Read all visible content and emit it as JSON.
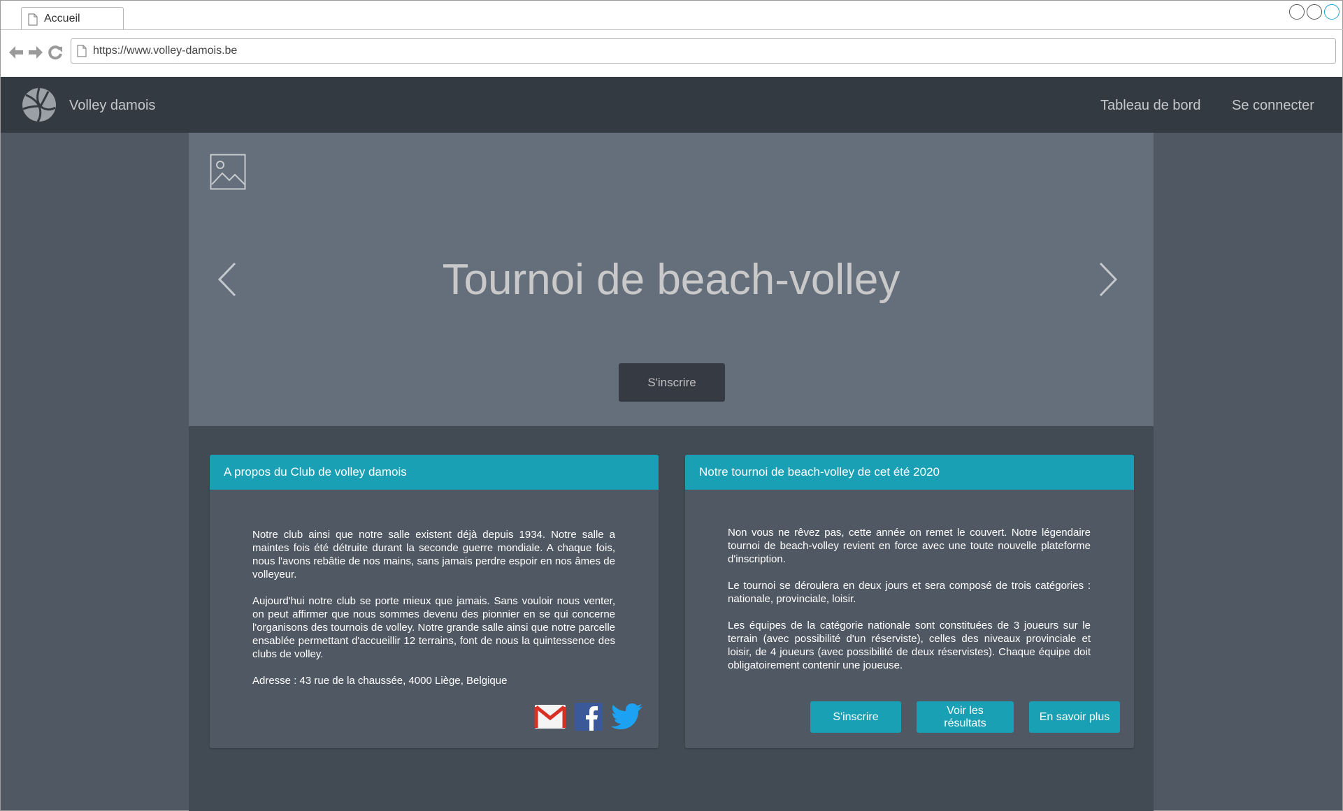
{
  "browser": {
    "tab_title": "Accueil",
    "url": "https://www.volley-damois.be"
  },
  "navbar": {
    "brand": "Volley damois",
    "links": [
      "Tableau de bord",
      "Se connecter"
    ]
  },
  "hero": {
    "title": "Tournoi de beach-volley",
    "button_label": "S'inscrire"
  },
  "about": {
    "header": "A propos du Club de volley damois",
    "paragraphs": [
      "Notre club ainsi que notre salle existent déjà depuis 1934. Notre salle a maintes fois été détruite durant la seconde guerre mondiale. A chaque fois, nous l'avons rebâtie de nos mains, sans jamais perdre espoir en nos âmes de volleyeur.",
      "Aujourd'hui notre club se porte mieux que jamais. Sans vouloir nous venter, on peut affirmer que nous sommes devenu des pionnier en se qui concerne l'organisons des tournois de volley. Notre grande salle ainsi que notre parcelle ensablée permettant d'accueillir 12 terrains, font de nous la quintessence des clubs de volley.",
      "Adresse : 43 rue de la chaussée, 4000 Liège, Belgique"
    ],
    "social_icons": [
      "gmail-icon",
      "facebook-icon",
      "twitter-icon"
    ]
  },
  "tournament": {
    "header": "Notre tournoi de beach-volley de cet été 2020",
    "paragraphs": [
      "Non vous ne rêvez pas, cette année on remet le couvert. Notre légendaire tournoi de beach-volley revient en force avec une toute nouvelle plateforme d'inscription.",
      "Le tournoi se déroulera en deux jours et sera composé de trois catégories : nationale, provinciale, loisir.",
      "Les équipes de la catégorie nationale sont constituées de 3 joueurs sur le terrain (avec possibilité d'un réserviste), celles des niveaux provinciale et loisir, de 4 joueurs (avec possibilité de deux réservistes). Chaque équipe doit obligatoirement contenir une joueuse."
    ],
    "buttons": [
      "S'inscrire",
      "Voir les résultats",
      "En savoir plus"
    ]
  },
  "colors": {
    "navbar": "#343a42",
    "hero": "#646f7b",
    "content": "#424a54",
    "card": "#4f5863",
    "accent": "#1aa0b5"
  }
}
